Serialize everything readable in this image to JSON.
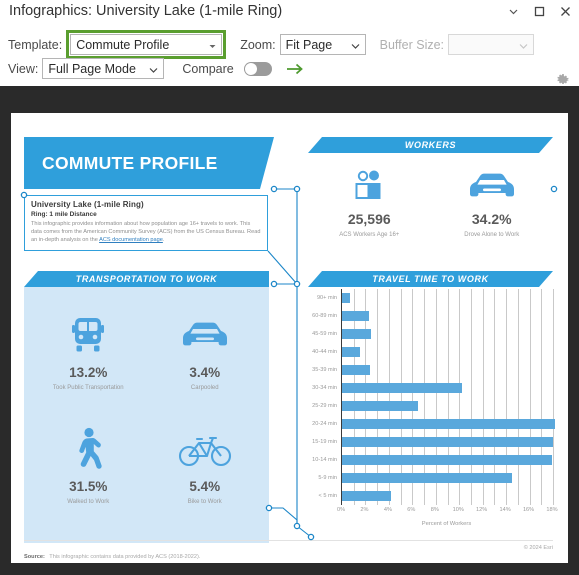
{
  "window": {
    "title": "Infographics: University Lake (1-mile Ring)",
    "controls": [
      {
        "name": "collapse-icon",
        "label": "Collapse"
      },
      {
        "name": "maximize-icon",
        "label": "Maximize"
      },
      {
        "name": "close-icon",
        "label": "Close"
      }
    ]
  },
  "toolbar": {
    "template_label": "Template:",
    "template_value": "Commute Profile",
    "zoom_label": "Zoom:",
    "zoom_value": "Fit Page",
    "buffer_label": "Buffer Size:",
    "buffer_value": "",
    "view_label": "View:",
    "view_value": "Full Page Mode",
    "compare_label": "Compare",
    "compare_on": false,
    "run_arrow": "→",
    "settings_icon": "gear-icon"
  },
  "infographic": {
    "title": "COMMUTE PROFILE",
    "description": {
      "title": "University Lake (1-mile Ring)",
      "subtitle": "Ring: 1 mile Distance",
      "body_before_link": "This infographic provides information about how population age 16+ travels to work. This data comes from the American Community Survey (ACS) from the US Census Bureau. Read an in-depth analysis on the ",
      "link_text": "ACS documentation page",
      "body_after_link": "."
    },
    "workers": {
      "heading": "WORKERS",
      "stats": [
        {
          "icon": "people-icon",
          "value": "25,596",
          "caption": "ACS Workers Age 16+"
        },
        {
          "icon": "car-icon",
          "value": "34.2%",
          "caption": "Drove Alone to Work"
        }
      ]
    },
    "transportation": {
      "heading": "TRANSPORTATION TO WORK",
      "stats": [
        {
          "icon": "train-icon",
          "value": "13.2%",
          "caption": "Took Public Transportation"
        },
        {
          "icon": "car-icon",
          "value": "3.4%",
          "caption": "Carpooled"
        },
        {
          "icon": "walking-icon",
          "value": "31.5%",
          "caption": "Walked to Work"
        },
        {
          "icon": "bicycle-icon",
          "value": "5.4%",
          "caption": "Bike to Work"
        }
      ]
    },
    "travel_time": {
      "heading": "TRAVEL TIME TO WORK"
    },
    "footer": {
      "source_label": "Source:",
      "source_text": "This infographic contains data provided by ACS (2018-2022).",
      "copyright": "© 2024 Esri"
    }
  },
  "colors": {
    "banner_blue": "#2f9fdb",
    "bar_blue": "#5aa8dc",
    "panel_light_blue": "#d2e7f7",
    "highlight_green": "#5a9e2f",
    "canvas_dark": "#2a2a2a"
  },
  "chart_data": {
    "type": "bar",
    "orientation": "horizontal",
    "title": "TRAVEL TIME TO WORK",
    "xlabel": "Percent of Workers",
    "ylabel": "",
    "xlim": [
      0,
      18
    ],
    "xticks": [
      0,
      2,
      4,
      6,
      8,
      10,
      12,
      14,
      16,
      18
    ],
    "xtick_labels": [
      "0%",
      "2%",
      "4%",
      "6%",
      "8%",
      "10%",
      "12%",
      "14%",
      "16%",
      "18%"
    ],
    "grid": true,
    "gridline_interval": 1,
    "legend": null,
    "categories": [
      "90+ min",
      "60-89 min",
      "45-59 min",
      "40-44 min",
      "35-39 min",
      "30-34 min",
      "25-29 min",
      "20-24 min",
      "15-19 min",
      "10-14 min",
      "5-9 min",
      "< 5 min"
    ],
    "values": [
      0.7,
      2.3,
      2.5,
      1.5,
      2.4,
      10.2,
      6.5,
      18.2,
      18.0,
      17.9,
      14.5,
      4.2
    ]
  }
}
